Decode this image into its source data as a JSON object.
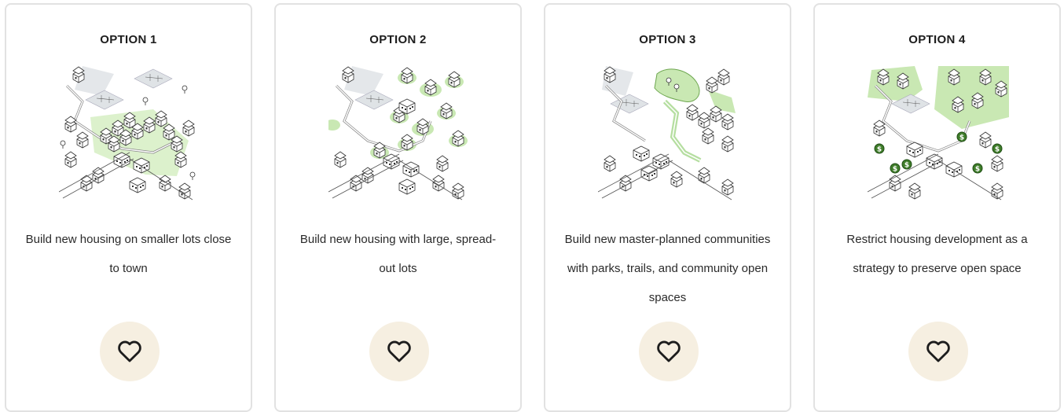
{
  "options": [
    {
      "title": "OPTION 1",
      "description": "Build new housing on smaller lots close to town",
      "illustration_icon": "isometric-town-illustration-icon",
      "favorite_icon": "heart-outline-icon"
    },
    {
      "title": "OPTION 2",
      "description": "Build new housing with large, spread-out lots",
      "illustration_icon": "isometric-town-illustration-icon",
      "favorite_icon": "heart-outline-icon"
    },
    {
      "title": "OPTION 3",
      "description": "Build new master-planned communities with parks, trails, and community open spaces",
      "illustration_icon": "isometric-town-illustration-icon",
      "favorite_icon": "heart-outline-icon"
    },
    {
      "title": "OPTION 4",
      "description": "Restrict housing development as a strategy to preserve open space",
      "illustration_icon": "isometric-town-illustration-icon",
      "favorite_icon": "heart-outline-icon"
    }
  ],
  "colors": {
    "accent_green": "#a9d88a",
    "dark_green": "#3f7d2a",
    "favorite_bg": "#f6efe1",
    "card_border": "#e2e2e2"
  }
}
